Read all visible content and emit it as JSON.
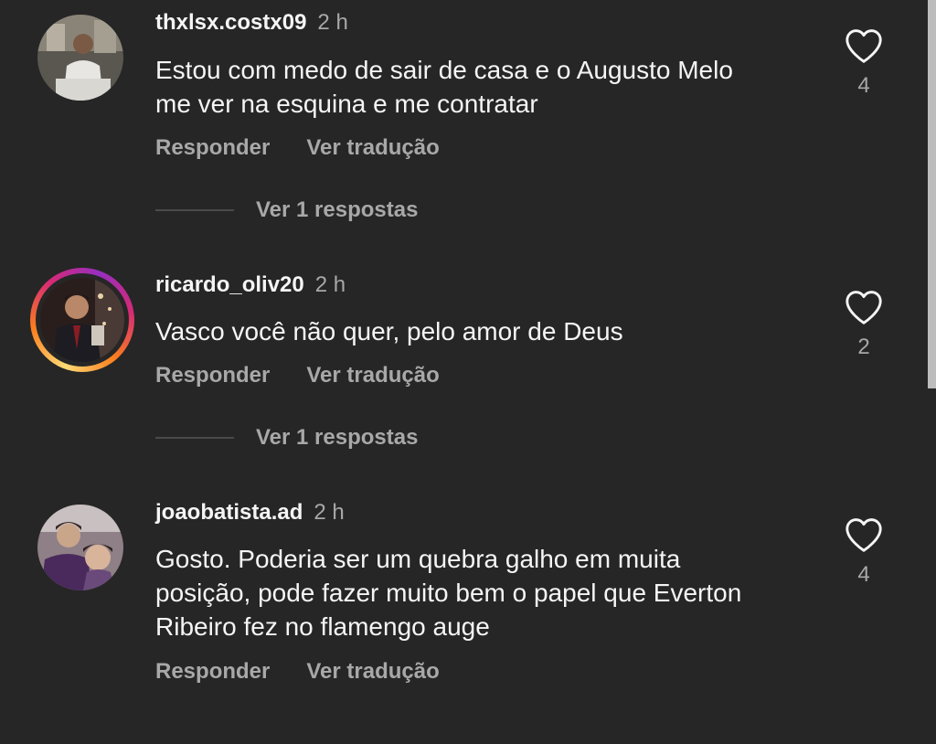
{
  "comments": [
    {
      "username": "thxlsx.costx09",
      "time": "2 h",
      "text_lines": [
        "Estou com medo de sair de casa e o Augusto Melo",
        "me ver na esquina e me contratar"
      ],
      "reply_label": "Responder",
      "translate_label": "Ver tradução",
      "likes": "4",
      "view_replies": "Ver 1 respostas",
      "avatar_icon": "avatar-photo",
      "has_story": false
    },
    {
      "username": "ricardo_oliv20",
      "time": "2 h",
      "text_lines": [
        "Vasco você não quer, pelo amor de Deus"
      ],
      "reply_label": "Responder",
      "translate_label": "Ver tradução",
      "likes": "2",
      "view_replies": "Ver 1 respostas",
      "avatar_icon": "avatar-photo",
      "has_story": true
    },
    {
      "username": "joaobatista.ad",
      "time": "2 h",
      "text_lines": [
        "Gosto.  Poderia ser um quebra galho em muita",
        "posição, pode fazer muito bem o papel que Everton",
        "Ribeiro fez no flamengo auge"
      ],
      "reply_label": "Responder",
      "translate_label": "Ver tradução",
      "likes": "4",
      "avatar_icon": "avatar-photo",
      "has_story": false
    }
  ],
  "colors": {
    "background": "#262626",
    "primary_text": "#f5f5f5",
    "secondary_text": "#a8a8a8",
    "story_ring": "#d62976"
  },
  "icons": {
    "like": "heart-outline-icon"
  }
}
